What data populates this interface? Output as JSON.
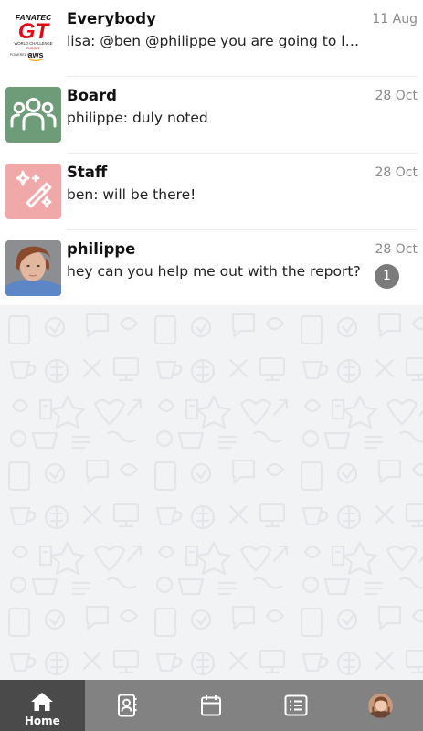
{
  "chats": [
    {
      "name": "Everybody",
      "preview": "lisa: @ben @philippe you are going to lik...",
      "date": "11 Aug",
      "avatar_icon": "fanatec-gt-logo",
      "logo_text": {
        "brand": "FANATEC",
        "mark": "GT",
        "sub": "WORLD CHALLENGE",
        "region": "EUROPE",
        "powered": "POWERED BY",
        "aws": "aws"
      }
    },
    {
      "name": "Board",
      "preview": "philippe: duly noted",
      "date": "28 Oct",
      "avatar_icon": "group-icon",
      "avatar_color": "#6e9c78"
    },
    {
      "name": "Staff",
      "preview": "ben: will be there!",
      "date": "28 Oct",
      "avatar_icon": "magic-wand-icon",
      "avatar_color": "#f1a8a8"
    },
    {
      "name": "philippe",
      "preview": "hey can you help me out with the report?",
      "date": "28 Oct",
      "avatar_icon": "user-photo",
      "unread": "1"
    }
  ],
  "nav": {
    "items": [
      {
        "icon": "home-icon",
        "label": "Home",
        "active": true
      },
      {
        "icon": "contacts-icon"
      },
      {
        "icon": "calendar-icon"
      },
      {
        "icon": "list-icon"
      },
      {
        "icon": "profile-avatar"
      }
    ]
  },
  "colors": {
    "nav_background": "#828282",
    "nav_active": "#4a4a4a",
    "badge": "#7b7b7b",
    "board_avatar": "#6e9c78",
    "staff_avatar": "#f1a8a8"
  }
}
